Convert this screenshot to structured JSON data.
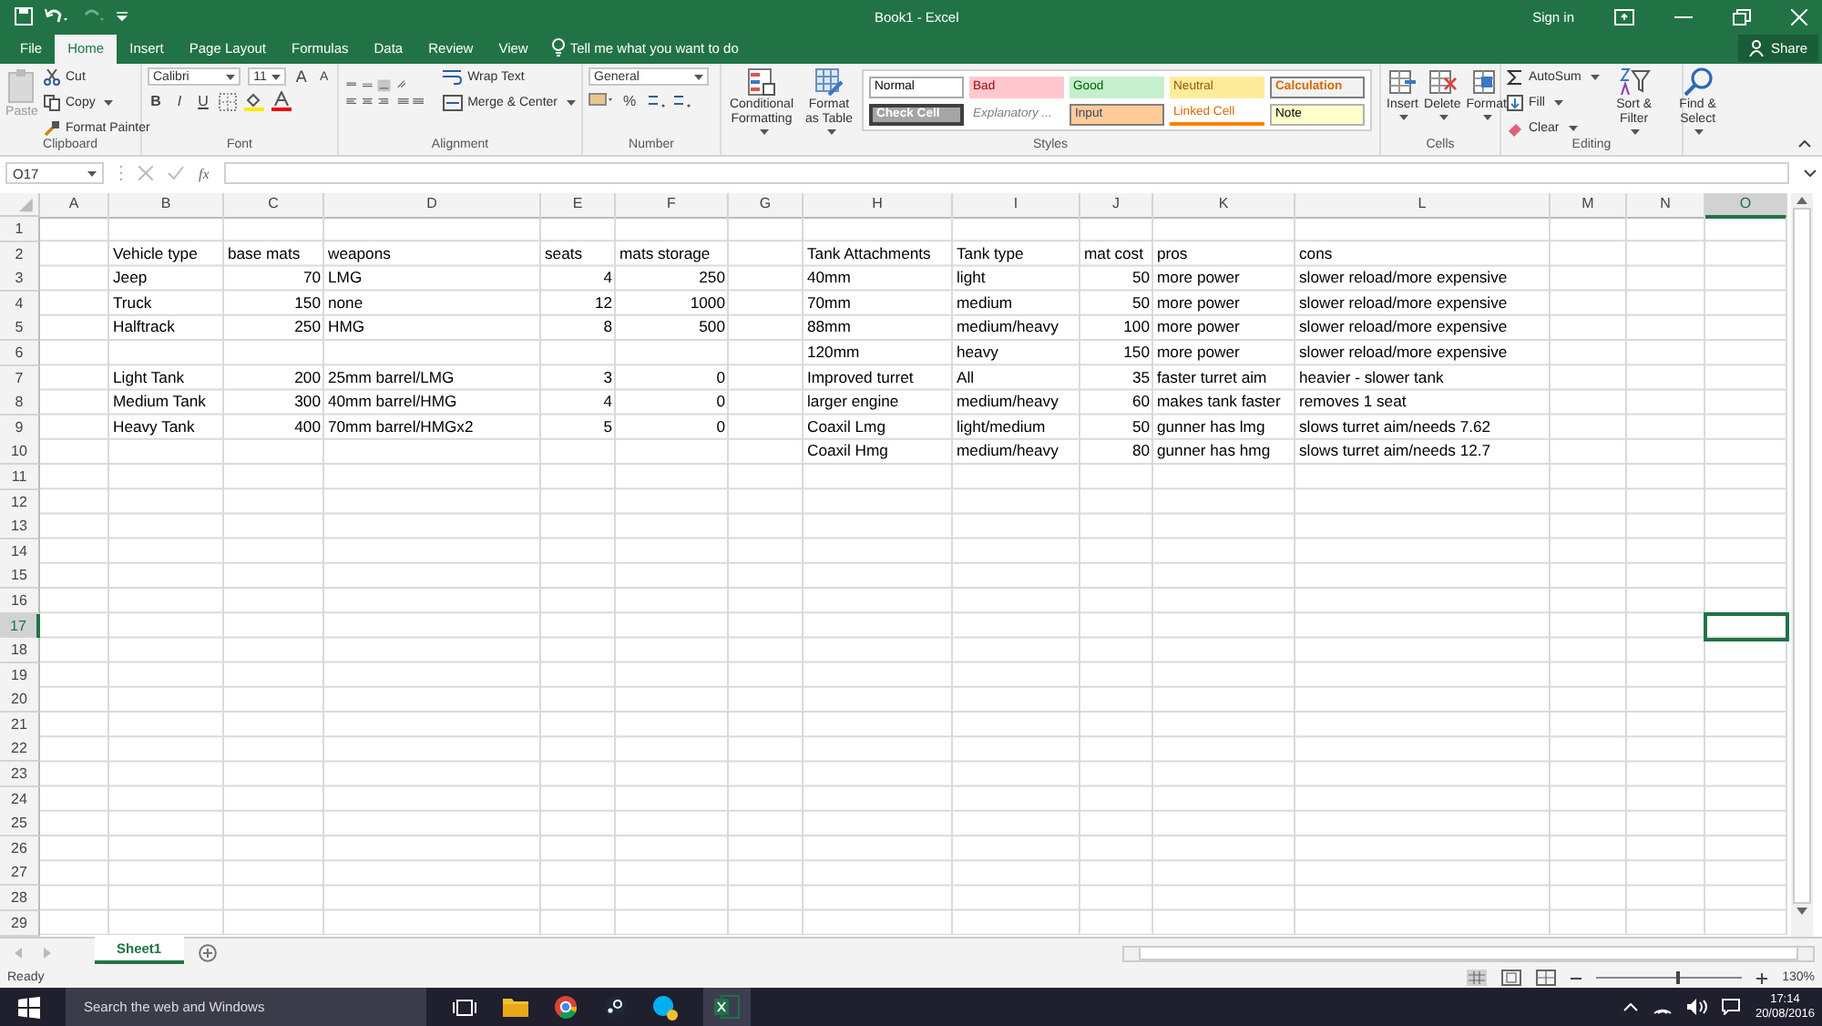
{
  "title_bar": {
    "title": "Book1 - Excel",
    "sign_in": "Sign in",
    "share": "Share"
  },
  "tabs": [
    {
      "label": "File",
      "selected": false
    },
    {
      "label": "Home",
      "selected": true
    },
    {
      "label": "Insert",
      "selected": false
    },
    {
      "label": "Page Layout",
      "selected": false
    },
    {
      "label": "Formulas",
      "selected": false
    },
    {
      "label": "Data",
      "selected": false
    },
    {
      "label": "Review",
      "selected": false
    },
    {
      "label": "View",
      "selected": false
    }
  ],
  "tell_me": "Tell me what you want to do",
  "ribbon": {
    "clipboard": {
      "label": "Clipboard",
      "paste": "Paste",
      "cut": "Cut",
      "copy": "Copy",
      "format_painter": "Format Painter"
    },
    "font": {
      "label": "Font",
      "name": "Calibri",
      "size": "11",
      "grow": "A",
      "shrink": "A",
      "bold": "B",
      "italic": "I",
      "underline": "U"
    },
    "alignment": {
      "label": "Alignment",
      "wrap": "Wrap Text",
      "merge": "Merge & Center"
    },
    "number": {
      "label": "Number",
      "format": "General",
      "percent": "%"
    },
    "styles": {
      "label": "Styles",
      "conditional": "Conditional Formatting",
      "format_table": "Format as Table",
      "gallery": [
        {
          "label": "Normal",
          "kind": "normal"
        },
        {
          "label": "Bad",
          "kind": "bad"
        },
        {
          "label": "Good",
          "kind": "good"
        },
        {
          "label": "Neutral",
          "kind": "neutral"
        },
        {
          "label": "Calculation",
          "kind": "calculation"
        },
        {
          "label": "Check Cell",
          "kind": "check"
        },
        {
          "label": "Explanatory ...",
          "kind": "explanatory"
        },
        {
          "label": "Input",
          "kind": "input"
        },
        {
          "label": "Linked Cell",
          "kind": "linked"
        },
        {
          "label": "Note",
          "kind": "note"
        }
      ]
    },
    "cells": {
      "label": "Cells",
      "buttons": [
        "Insert",
        "Delete",
        "Format"
      ]
    },
    "editing": {
      "label": "Editing",
      "autosum": "AutoSum",
      "fill": "Fill",
      "clear": "Clear",
      "sort": "Sort & Filter",
      "find": "Find & Select"
    }
  },
  "name_box": "O17",
  "function_label": "fx",
  "columns": [
    {
      "label": "A",
      "selected": false
    },
    {
      "label": "B",
      "selected": false
    },
    {
      "label": "C",
      "selected": false
    },
    {
      "label": "D",
      "selected": false
    },
    {
      "label": "E",
      "selected": false
    },
    {
      "label": "F",
      "selected": false
    },
    {
      "label": "G",
      "selected": false
    },
    {
      "label": "H",
      "selected": false
    },
    {
      "label": "I",
      "selected": false
    },
    {
      "label": "J",
      "selected": false
    },
    {
      "label": "K",
      "selected": false
    },
    {
      "label": "L",
      "selected": false
    },
    {
      "label": "M",
      "selected": false
    },
    {
      "label": "N",
      "selected": false
    },
    {
      "label": "O",
      "selected": true
    }
  ],
  "rows": [
    {
      "header": "1",
      "selected": false
    },
    {
      "header": "2",
      "selected": false,
      "cells": {
        "B": {
          "text": "Vehicle type",
          "kind": "text"
        },
        "C": {
          "text": "base mats",
          "kind": "text"
        },
        "D": {
          "text": "weapons",
          "kind": "text"
        },
        "E": {
          "text": "seats",
          "kind": "text"
        },
        "F": {
          "text": "mats storage",
          "kind": "text"
        },
        "H": {
          "text": "Tank Attachments",
          "kind": "text"
        },
        "I": {
          "text": "Tank type",
          "kind": "text"
        },
        "J": {
          "text": "mat cost",
          "kind": "text"
        },
        "K": {
          "text": "pros",
          "kind": "text"
        },
        "L": {
          "text": "cons",
          "kind": "text"
        }
      }
    },
    {
      "header": "3",
      "selected": false,
      "cells": {
        "B": {
          "text": "Jeep",
          "kind": "text"
        },
        "C": {
          "text": "70",
          "kind": "number"
        },
        "D": {
          "text": "LMG",
          "kind": "text"
        },
        "E": {
          "text": "4",
          "kind": "number"
        },
        "F": {
          "text": "250",
          "kind": "number"
        },
        "H": {
          "text": "40mm",
          "kind": "text"
        },
        "I": {
          "text": "light",
          "kind": "text"
        },
        "J": {
          "text": "50",
          "kind": "number"
        },
        "K": {
          "text": "more power",
          "kind": "text"
        },
        "L": {
          "text": "slower reload/more expensive",
          "kind": "text"
        }
      }
    },
    {
      "header": "4",
      "selected": false,
      "cells": {
        "B": {
          "text": "Truck",
          "kind": "text"
        },
        "C": {
          "text": "150",
          "kind": "number"
        },
        "D": {
          "text": "none",
          "kind": "text"
        },
        "E": {
          "text": "12",
          "kind": "number"
        },
        "F": {
          "text": "1000",
          "kind": "number"
        },
        "H": {
          "text": "70mm",
          "kind": "text"
        },
        "I": {
          "text": "medium",
          "kind": "text"
        },
        "J": {
          "text": "50",
          "kind": "number"
        },
        "K": {
          "text": "more power",
          "kind": "text"
        },
        "L": {
          "text": "slower reload/more expensive",
          "kind": "text"
        }
      }
    },
    {
      "header": "5",
      "selected": false,
      "cells": {
        "B": {
          "text": "Halftrack",
          "kind": "text"
        },
        "C": {
          "text": "250",
          "kind": "number"
        },
        "D": {
          "text": "HMG",
          "kind": "text"
        },
        "E": {
          "text": "8",
          "kind": "number"
        },
        "F": {
          "text": "500",
          "kind": "number"
        },
        "H": {
          "text": "88mm",
          "kind": "text"
        },
        "I": {
          "text": "medium/heavy",
          "kind": "text"
        },
        "J": {
          "text": "100",
          "kind": "number"
        },
        "K": {
          "text": "more power",
          "kind": "text"
        },
        "L": {
          "text": "slower reload/more expensive",
          "kind": "text"
        }
      }
    },
    {
      "header": "6",
      "selected": false,
      "cells": {
        "H": {
          "text": "120mm",
          "kind": "text"
        },
        "I": {
          "text": "heavy",
          "kind": "text"
        },
        "J": {
          "text": "150",
          "kind": "number"
        },
        "K": {
          "text": "more power",
          "kind": "text"
        },
        "L": {
          "text": "slower reload/more expensive",
          "kind": "text"
        }
      }
    },
    {
      "header": "7",
      "selected": false,
      "cells": {
        "B": {
          "text": "Light Tank",
          "kind": "text"
        },
        "C": {
          "text": "200",
          "kind": "number"
        },
        "D": {
          "text": "25mm barrel/LMG",
          "kind": "text"
        },
        "E": {
          "text": "3",
          "kind": "number"
        },
        "F": {
          "text": "0",
          "kind": "number"
        },
        "H": {
          "text": "Improved turret",
          "kind": "text"
        },
        "I": {
          "text": "All",
          "kind": "text"
        },
        "J": {
          "text": "35",
          "kind": "number"
        },
        "K": {
          "text": "faster turret aim",
          "kind": "text"
        },
        "L": {
          "text": "heavier - slower tank",
          "kind": "text"
        }
      }
    },
    {
      "header": "8",
      "selected": false,
      "cells": {
        "B": {
          "text": "Medium Tank",
          "kind": "text"
        },
        "C": {
          "text": "300",
          "kind": "number"
        },
        "D": {
          "text": "40mm barrel/HMG",
          "kind": "text"
        },
        "E": {
          "text": "4",
          "kind": "number"
        },
        "F": {
          "text": "0",
          "kind": "number"
        },
        "H": {
          "text": "larger engine",
          "kind": "text"
        },
        "I": {
          "text": "medium/heavy",
          "kind": "text"
        },
        "J": {
          "text": "60",
          "kind": "number"
        },
        "K": {
          "text": "makes tank faster",
          "kind": "text"
        },
        "L": {
          "text": "removes 1 seat",
          "kind": "text"
        }
      }
    },
    {
      "header": "9",
      "selected": false,
      "cells": {
        "B": {
          "text": "Heavy Tank",
          "kind": "text"
        },
        "C": {
          "text": "400",
          "kind": "number"
        },
        "D": {
          "text": "70mm barrel/HMGx2",
          "kind": "text"
        },
        "E": {
          "text": "5",
          "kind": "number"
        },
        "F": {
          "text": "0",
          "kind": "number"
        },
        "H": {
          "text": "Coaxil Lmg",
          "kind": "text"
        },
        "I": {
          "text": "light/medium",
          "kind": "text"
        },
        "J": {
          "text": "50",
          "kind": "number"
        },
        "K": {
          "text": "gunner has lmg",
          "kind": "text"
        },
        "L": {
          "text": "slows turret aim/needs 7.62",
          "kind": "text"
        }
      }
    },
    {
      "header": "10",
      "selected": false,
      "cells": {
        "H": {
          "text": "Coaxil Hmg",
          "kind": "text"
        },
        "I": {
          "text": "medium/heavy",
          "kind": "text"
        },
        "J": {
          "text": "80",
          "kind": "number"
        },
        "K": {
          "text": "gunner has hmg",
          "kind": "text"
        },
        "L": {
          "text": "slows turret aim/needs 12.7",
          "kind": "text"
        }
      }
    },
    {
      "header": "11",
      "selected": false
    },
    {
      "header": "12",
      "selected": false
    },
    {
      "header": "13",
      "selected": false
    },
    {
      "header": "14",
      "selected": false
    },
    {
      "header": "15",
      "selected": false
    },
    {
      "header": "16",
      "selected": false
    },
    {
      "header": "17",
      "selected": true
    },
    {
      "header": "18",
      "selected": false
    },
    {
      "header": "19",
      "selected": false
    },
    {
      "header": "20",
      "selected": false
    },
    {
      "header": "21",
      "selected": false
    },
    {
      "header": "22",
      "selected": false
    },
    {
      "header": "23",
      "selected": false
    },
    {
      "header": "24",
      "selected": false
    },
    {
      "header": "25",
      "selected": false
    },
    {
      "header": "26",
      "selected": false
    },
    {
      "header": "27",
      "selected": false
    },
    {
      "header": "28",
      "selected": false
    },
    {
      "header": "29",
      "selected": false
    }
  ],
  "sheets": [
    {
      "label": "Sheet1",
      "selected": true
    }
  ],
  "status": {
    "text": "Ready",
    "zoom": "130%",
    "level": 0.55
  },
  "taskbar": {
    "search": "Search the web and Windows",
    "time": "17:14",
    "date": "20/08/2016"
  }
}
